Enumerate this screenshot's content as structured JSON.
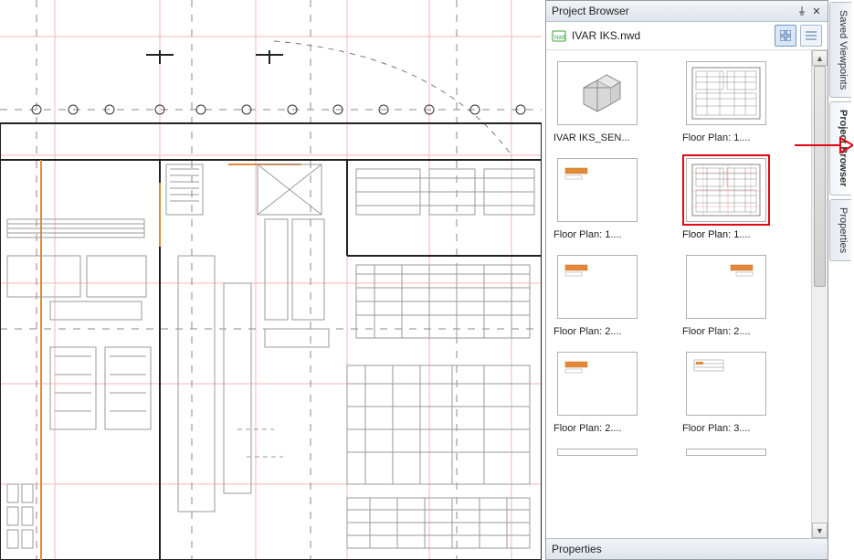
{
  "panel": {
    "title": "Project Browser"
  },
  "file": {
    "name": "IVAR IKS.nwd"
  },
  "thumbnails": [
    {
      "label": "IVAR IKS_SEN...",
      "kind": "3d",
      "selected": false
    },
    {
      "label": "Floor Plan: 1....",
      "kind": "plan-detailed",
      "selected": false
    },
    {
      "label": "Floor Plan: 1....",
      "kind": "plan-tiny",
      "selected": false
    },
    {
      "label": "Floor Plan: 1....",
      "kind": "plan-detailed-red",
      "selected": true
    },
    {
      "label": "Floor Plan: 2....",
      "kind": "plan-tiny",
      "selected": false
    },
    {
      "label": "Floor Plan: 2....",
      "kind": "plan-tiny-r",
      "selected": false
    },
    {
      "label": "Floor Plan: 2....",
      "kind": "plan-tiny",
      "selected": false
    },
    {
      "label": "Floor Plan: 3....",
      "kind": "plan-small",
      "selected": false
    }
  ],
  "properties": {
    "title": "Properties"
  },
  "side_tabs": [
    {
      "label": "Saved Viewpoints",
      "active": false
    },
    {
      "label": "Project Browser",
      "active": true
    },
    {
      "label": "Properties",
      "active": false
    }
  ]
}
